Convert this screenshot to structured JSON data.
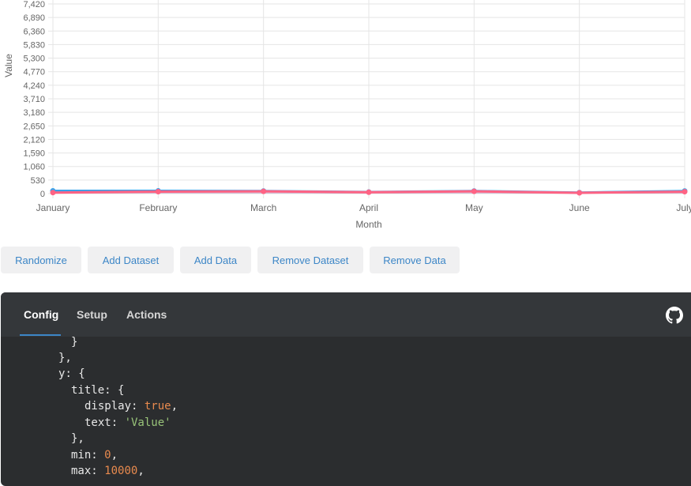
{
  "chart_data": {
    "type": "line",
    "categories": [
      "January",
      "February",
      "March",
      "April",
      "May",
      "June",
      "July"
    ],
    "series": [
      {
        "values": [
          107,
          107,
          100,
          60,
          100,
          40,
          100
        ],
        "color": "#36a2eb",
        "fill_color": "#36a2eb"
      },
      {
        "values": [
          40,
          77,
          90,
          55,
          88,
          32,
          75
        ],
        "color": "#ff6384",
        "fill_color": "#ff6384"
      }
    ],
    "xlabel": "Month",
    "ylabel": "Value",
    "y_ticks": [
      "0",
      "530",
      "1,060",
      "1,590",
      "2,120",
      "2,650",
      "3,180",
      "3,710",
      "4,240",
      "4,770",
      "5,300",
      "5,830",
      "6,360",
      "6,890",
      "7,420"
    ],
    "grid": true
  },
  "buttons": {
    "randomize": "Randomize",
    "add_dataset": "Add Dataset",
    "add_data": "Add Data",
    "remove_dataset": "Remove Dataset",
    "remove_data": "Remove Data"
  },
  "tabs": [
    {
      "label": "Config",
      "active": true
    },
    {
      "label": "Setup",
      "active": false
    },
    {
      "label": "Actions",
      "active": false
    }
  ],
  "code": {
    "l1": "}",
    "l2": "},",
    "l3_key": "y",
    "l3_rest": ": {",
    "l4_key": "title",
    "l4_rest": ": {",
    "l5_key": "display",
    "l5_sep": ": ",
    "l5_val": "true",
    "l5_end": ",",
    "l6_key": "text",
    "l6_sep": ": ",
    "l6_val": "'Value'",
    "l7": "},",
    "l8_key": "min",
    "l8_sep": ": ",
    "l8_val": "0",
    "l8_end": ",",
    "l9_key": "max",
    "l9_sep": ": ",
    "l9_val": "10000",
    "l9_end": ","
  },
  "icons": {
    "github": "github-icon"
  }
}
